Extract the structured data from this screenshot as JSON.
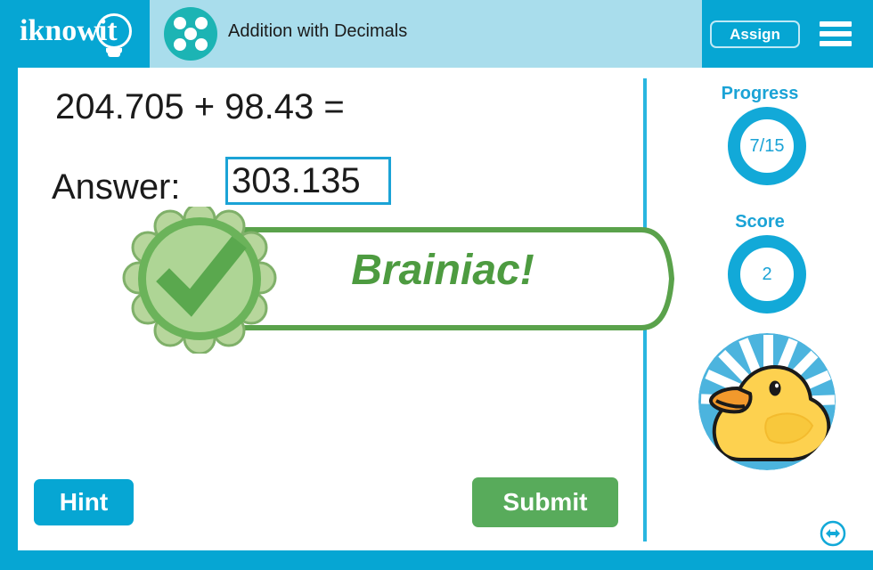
{
  "header": {
    "logo_text": "iknowit",
    "logo_icon": "lightbulb-icon",
    "subject_icon": "five-dots-icon",
    "title": "Addition with Decimals",
    "assign_label": "Assign",
    "menu_icon": "hamburger-menu-icon"
  },
  "problem": {
    "expression": "204.705 + 98.43 =",
    "answer_label": "Answer:",
    "answer_value": "303.135",
    "answer_placeholder": ""
  },
  "feedback": {
    "message": "Brainiac!",
    "badge_icon": "check-rosette-icon",
    "correct": true
  },
  "actions": {
    "hint_label": "Hint",
    "submit_label": "Submit"
  },
  "sidebar": {
    "progress_label": "Progress",
    "progress_value": "7/15",
    "score_label": "Score",
    "score_value": "2",
    "avatar_icon": "rubber-duck-avatar"
  },
  "footer": {
    "resize_icon": "resize-horizontal-icon"
  },
  "colors": {
    "brand_blue": "#06a6d3",
    "header_band": "#a9ddec",
    "subject_teal": "#1cb4b4",
    "accent_blue": "#1ba3d6",
    "ring_blue": "#12a9d8",
    "submit_green": "#58ab5b",
    "feedback_green": "#4d9b40",
    "badge_light_green": "#a8d28d",
    "duck_yellow": "#fcd24e"
  }
}
